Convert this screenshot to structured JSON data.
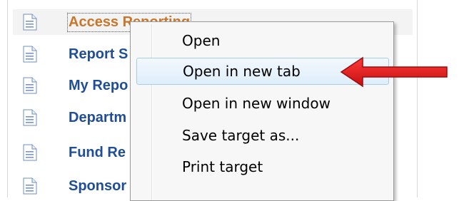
{
  "report_list": {
    "items": [
      {
        "label": "Access Reporting",
        "icon": "document-icon"
      },
      {
        "label": "Report S",
        "icon": "document-icon"
      },
      {
        "label": "My Repo",
        "icon": "document-icon"
      },
      {
        "label": "Departm",
        "icon": "document-icon"
      },
      {
        "label": "Fund Re",
        "icon": "document-icon"
      },
      {
        "label": "Sponsor",
        "icon": "document-icon"
      }
    ]
  },
  "context_menu": {
    "items": [
      {
        "label": "Open"
      },
      {
        "label": "Open in new tab"
      },
      {
        "label": "Open in new window"
      },
      {
        "label": "Save target as..."
      },
      {
        "label": "Print target"
      }
    ],
    "selected_item": "Open in new tab"
  },
  "annotation": {
    "icon": "red-arrow-icon",
    "color": "#e01c1c"
  },
  "colors": {
    "link": "#1f4e97",
    "hover_link": "#c8762a",
    "menu_background": "#f7f7f7",
    "highlight_border": "#a8cbea"
  }
}
